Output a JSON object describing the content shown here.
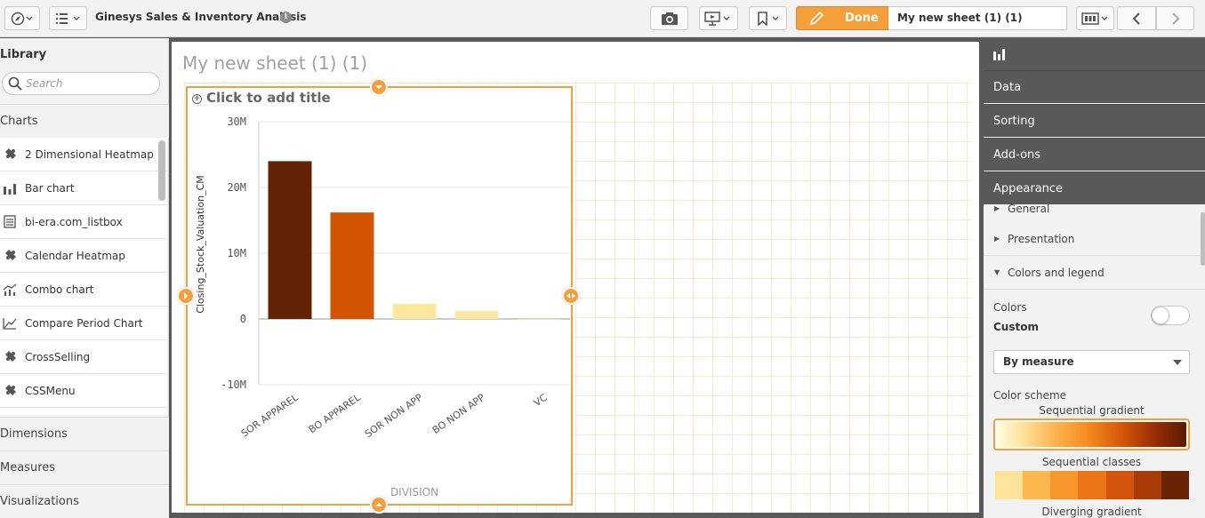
{
  "app": {
    "title": "Ginesys Sales & Inventory Analysis"
  },
  "toolbar": {
    "done_label": "Done",
    "sheet_name": "My new sheet (1) (1)"
  },
  "library": {
    "title": "Library",
    "search_placeholder": "Search",
    "charts_label": "Charts",
    "chart_items": [
      {
        "label": "2 Dimensional Heatmap",
        "icon": "puzzle-icon"
      },
      {
        "label": "Bar chart",
        "icon": "bar-chart-icon"
      },
      {
        "label": "bi-era.com_listbox",
        "icon": "list-icon"
      },
      {
        "label": "Calendar Heatmap",
        "icon": "puzzle-icon"
      },
      {
        "label": "Combo chart",
        "icon": "combo-chart-icon"
      },
      {
        "label": "Compare Period Chart",
        "icon": "line-chart-icon"
      },
      {
        "label": "CrossSelling",
        "icon": "puzzle-icon"
      },
      {
        "label": "CSSMenu",
        "icon": "puzzle-icon"
      }
    ],
    "dimensions_label": "Dimensions",
    "measures_label": "Measures",
    "visualizations_label": "Visualizations"
  },
  "sheet": {
    "title": "My new sheet (1) (1)",
    "add_title": "Click to add title"
  },
  "chart_data": {
    "type": "bar",
    "categories": [
      "SOR APPAREL",
      "BO APPAREL",
      "SOR NON APP",
      "BO NON APP",
      "VC"
    ],
    "values": [
      24000000,
      16200000,
      2300000,
      1200000,
      -100000
    ],
    "colors": [
      "#642204",
      "#d35400",
      "#fce79a",
      "#fce79a",
      "#fce79a"
    ],
    "xlabel": "DIVISION",
    "ylabel": "Closing_Stock_Valuation_CM",
    "ylim": [
      -10000000,
      30000000
    ],
    "yticks": [
      {
        "value": 30000000,
        "label": "30M"
      },
      {
        "value": 20000000,
        "label": "20M"
      },
      {
        "value": 10000000,
        "label": "10M"
      },
      {
        "value": 0,
        "label": "0"
      },
      {
        "value": -10000000,
        "label": "-10M"
      }
    ],
    "grid": true
  },
  "properties": {
    "tabs": [
      "Data",
      "Sorting",
      "Add-ons",
      "Appearance"
    ],
    "sections": [
      "General",
      "Presentation",
      "Colors and legend"
    ],
    "colors_label": "Colors",
    "colors_mode": "Custom",
    "color_by": "By measure",
    "color_scheme_label": "Color scheme",
    "scheme_sequential_gradient": "Sequential gradient",
    "scheme_sequential_classes": "Sequential classes",
    "scheme_diverging_gradient": "Diverging gradient",
    "class_colors": [
      "#fde49a",
      "#fcb84e",
      "#f7962a",
      "#ec7617",
      "#d5540b",
      "#a83c07",
      "#6b2305"
    ]
  }
}
